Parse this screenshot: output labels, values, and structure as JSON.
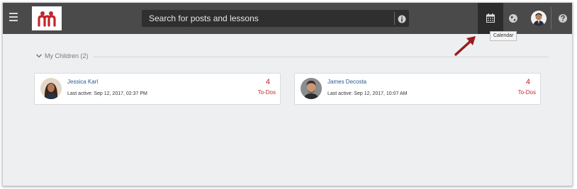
{
  "search": {
    "placeholder": "Search for posts and lessons"
  },
  "tooltip": {
    "text": "Calendar"
  },
  "section": {
    "title": "My Children (2)"
  },
  "children": [
    {
      "name": "Jessica Karl",
      "last_active": "Last active: Sep 12, 2017, 02:37 PM",
      "todo_count": "4",
      "todo_label": "To-Dos"
    },
    {
      "name": "James Decosta",
      "last_active": "Last active: Sep 12, 2017, 10:07 AM",
      "todo_count": "4",
      "todo_label": "To-Dos"
    }
  ],
  "icons": [
    "menu-icon",
    "logo",
    "info-icon",
    "calendar-icon",
    "globe-icon",
    "avatar",
    "help-icon",
    "chevron-down-icon"
  ],
  "colors": {
    "topbar": "#4a4a4a",
    "accent": "#c0272d",
    "link": "#2b5a8c",
    "background": "#eeeff1"
  }
}
